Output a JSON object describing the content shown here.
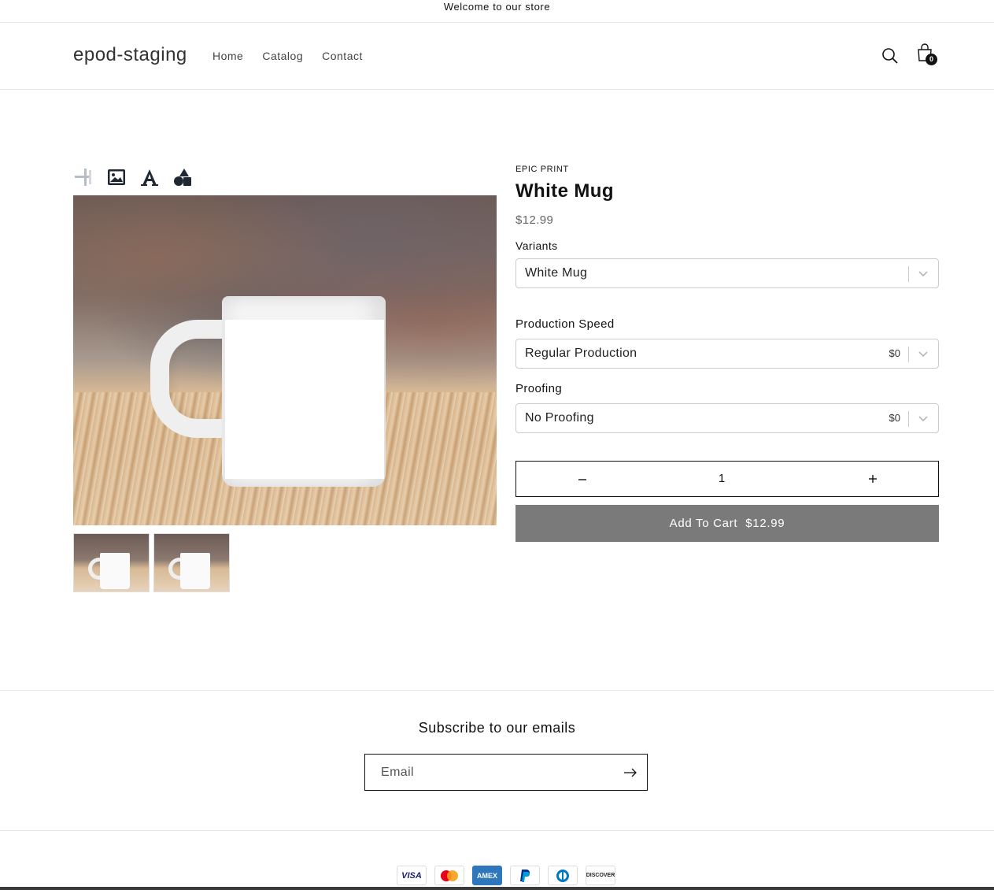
{
  "announcement": "Welcome to our store",
  "header": {
    "logo": "epod-staging",
    "nav": [
      "Home",
      "Catalog",
      "Contact"
    ],
    "cart_count": "0"
  },
  "tools": [
    "add-layout-icon",
    "image-icon",
    "text-icon",
    "shapes-icon"
  ],
  "product": {
    "vendor": "EPIC PRINT",
    "title": "White Mug",
    "price": "$12.99",
    "variants_label": "Variants",
    "variant_value": "White Mug",
    "production_label": "Production Speed",
    "production_value": "Regular Production",
    "production_price": "$0",
    "proofing_label": "Proofing",
    "proofing_value": "No Proofing",
    "proofing_price": "$0",
    "quantity": "1",
    "add_to_cart": "Add To Cart",
    "add_to_cart_price": "$12.99"
  },
  "footer": {
    "subscribe_title": "Subscribe to our emails",
    "email_placeholder": "Email",
    "payments": [
      "VISA",
      "Mastercard",
      "AMEX",
      "PayPal",
      "Diners Club",
      "DISCOVER"
    ]
  },
  "colors": {
    "add_to_cart_bg": "#7a7a7a",
    "text": "#121212"
  }
}
